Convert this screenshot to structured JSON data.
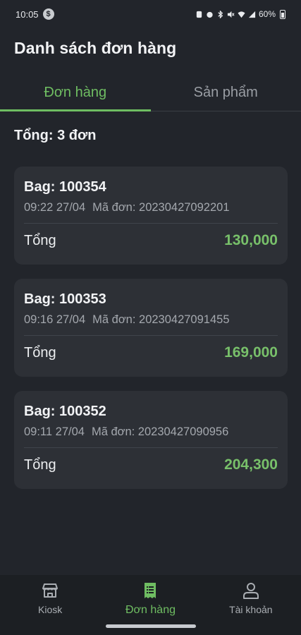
{
  "status_bar": {
    "time": "10:05",
    "left_badge": "$",
    "battery": "60%"
  },
  "header": {
    "title": "Danh sách đơn hàng"
  },
  "tabs": [
    {
      "label": "Đơn hàng",
      "active": true
    },
    {
      "label": "Sản phẩm",
      "active": false
    }
  ],
  "summary": "Tổng: 3 đơn",
  "orders": [
    {
      "bag": "Bag: 100354",
      "time": "09:22 27/04",
      "code": "Mã đơn: 20230427092201",
      "total_label": "Tổng",
      "total": "130,000"
    },
    {
      "bag": "Bag: 100353",
      "time": "09:16 27/04",
      "code": "Mã đơn: 20230427091455",
      "total_label": "Tổng",
      "total": "169,000"
    },
    {
      "bag": "Bag: 100352",
      "time": "09:11 27/04",
      "code": "Mã đơn: 20230427090956",
      "total_label": "Tổng",
      "total": "204,300"
    }
  ],
  "bottom_nav": [
    {
      "label": "Kiosk",
      "icon": "store-icon",
      "active": false
    },
    {
      "label": "Đơn hàng",
      "icon": "receipt-icon",
      "active": true
    },
    {
      "label": "Tài khoản",
      "icon": "user-icon",
      "active": false
    }
  ],
  "colors": {
    "accent": "#6fbd62",
    "background": "#22252b",
    "card": "#2d3036"
  }
}
